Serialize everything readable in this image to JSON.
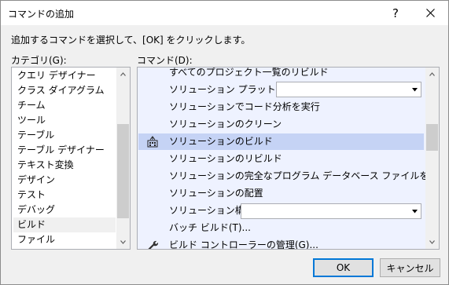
{
  "window": {
    "title": "コマンドの追加",
    "help_label": "?"
  },
  "instruction": "追加するコマンドを選択して、[OK] をクリックします。",
  "categories": {
    "label": "カテゴリ(G):",
    "items": [
      {
        "label": "クエリ デザイナー"
      },
      {
        "label": "クラス ダイアグラム"
      },
      {
        "label": "チーム"
      },
      {
        "label": "ツール"
      },
      {
        "label": "テーブル"
      },
      {
        "label": "テーブル デザイナー"
      },
      {
        "label": "テキスト変換"
      },
      {
        "label": "デザイン"
      },
      {
        "label": "テスト"
      },
      {
        "label": "デバッグ"
      },
      {
        "label": "ビルド"
      },
      {
        "label": "ファイル"
      }
    ],
    "selected": "ビルド"
  },
  "commands": {
    "label": "コマンド(D):",
    "items": [
      {
        "label": "すべてのプロジェクト一覧のリビルド"
      },
      {
        "label": "ソリューション プラットフォーム",
        "combo_value": ""
      },
      {
        "label": "ソリューションでコード分析を実行"
      },
      {
        "label": "ソリューションのクリーン"
      },
      {
        "label": "ソリューションのビルド",
        "icon": "build-solution-icon"
      },
      {
        "label": "ソリューションのリビルド"
      },
      {
        "label": "ソリューションの完全なプログラム データベース ファイルを構築する"
      },
      {
        "label": "ソリューションの配置"
      },
      {
        "label": "ソリューション構成",
        "combo_value": ""
      },
      {
        "label": "バッチ ビルド(T)..."
      },
      {
        "label": "ビルド コントローラーの管理(G)...",
        "icon": "wrench-icon"
      }
    ],
    "selected": "ソリューションのビルド"
  },
  "buttons": {
    "ok": "OK",
    "cancel": "キャンセル"
  },
  "colors": {
    "selection_commands": "#c5d3f5",
    "commands_background": "#eef2ff",
    "default_button_border": "#0078d7"
  }
}
